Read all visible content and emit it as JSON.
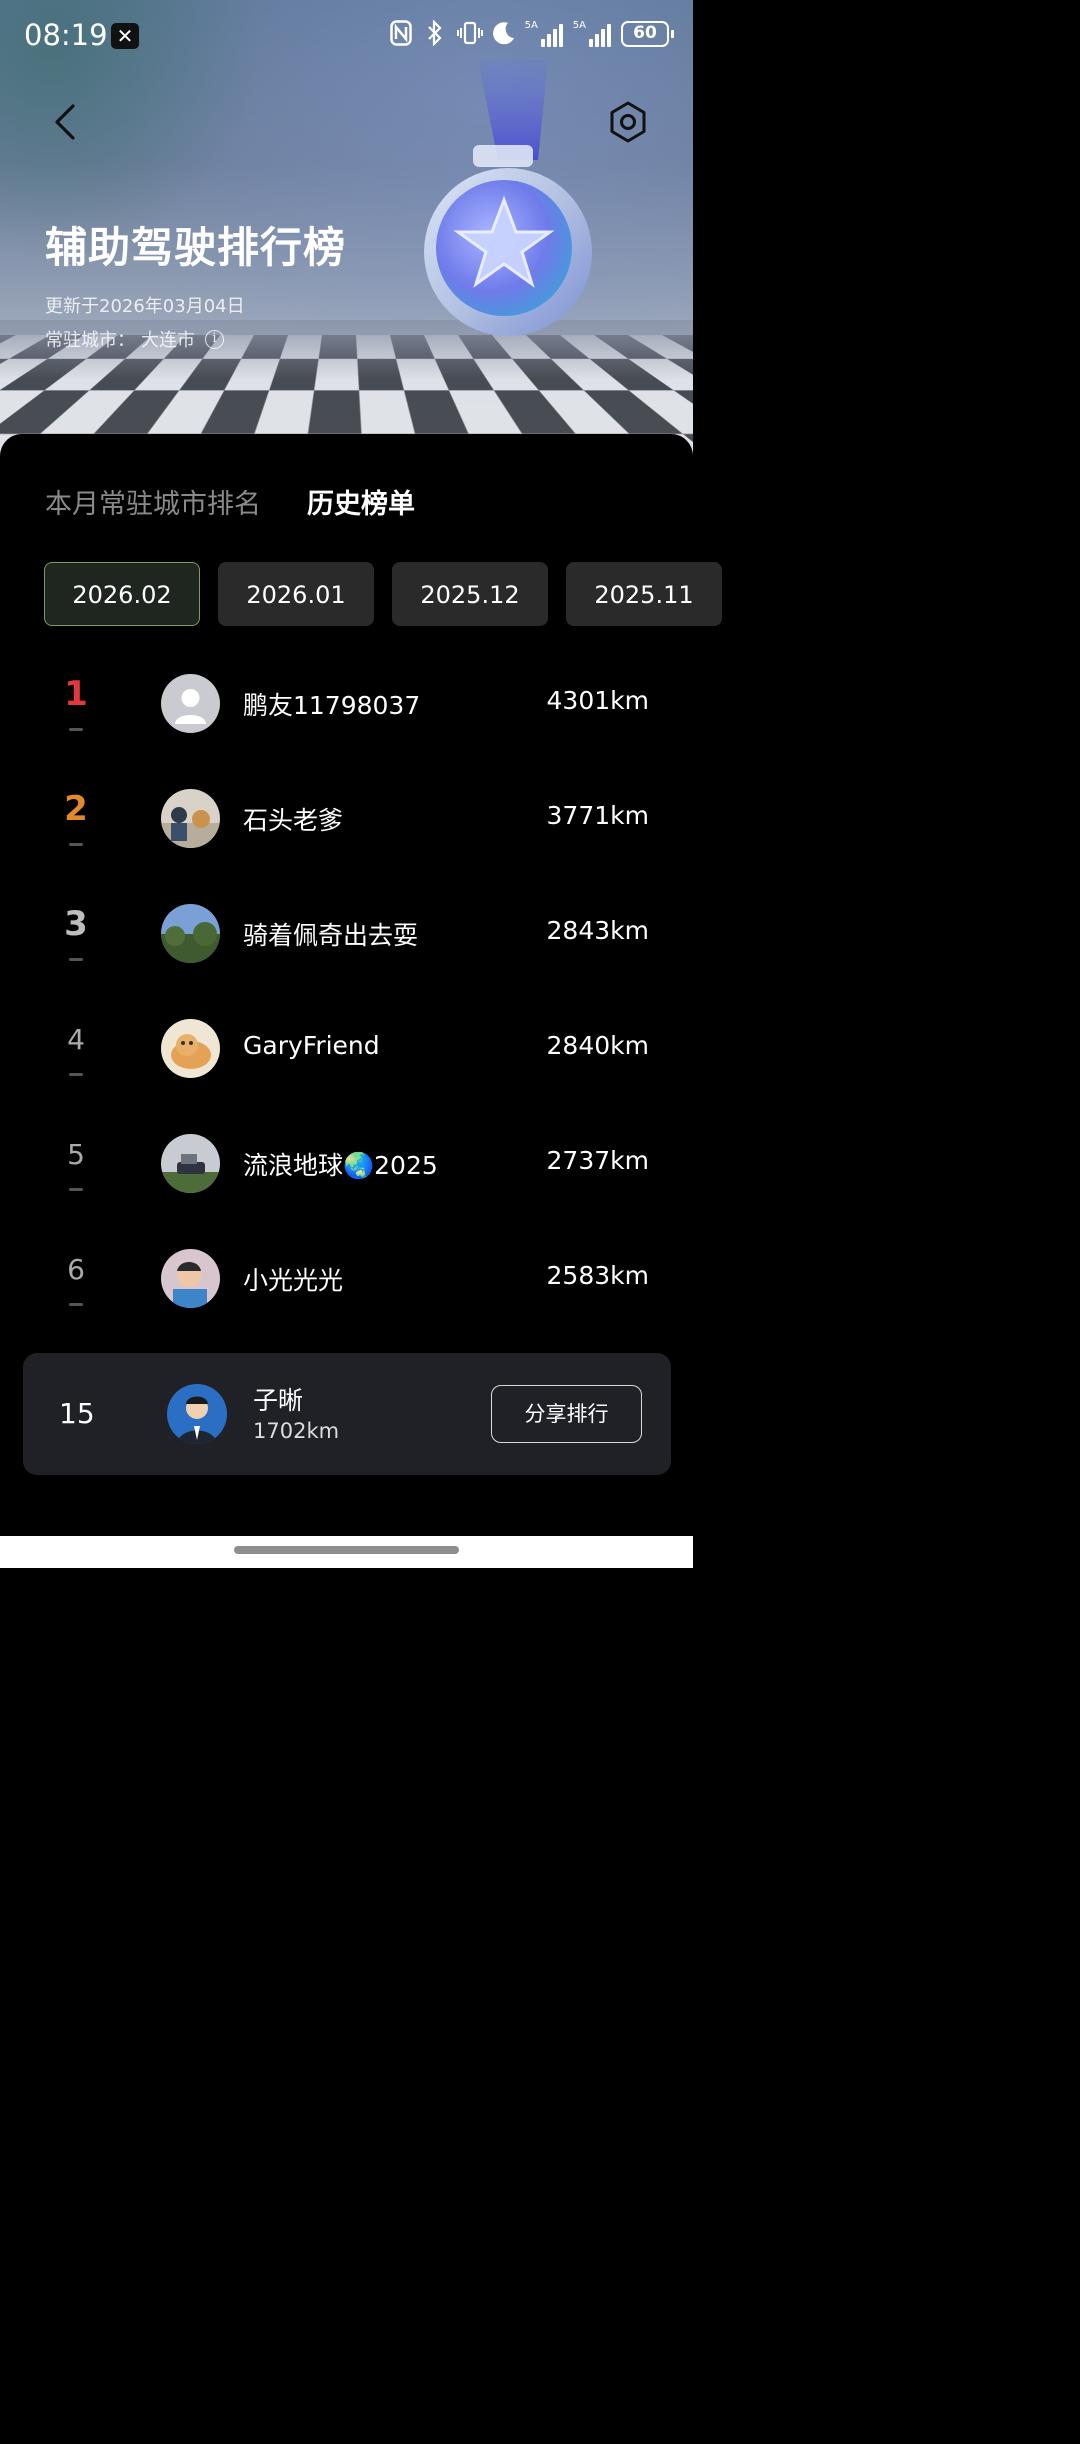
{
  "status_bar": {
    "time": "08:19",
    "signal1_label": "5A",
    "signal2_label": "5A",
    "battery": "60",
    "icons": [
      "app-x-icon",
      "nfc-icon",
      "bluetooth-icon",
      "vibrate-icon",
      "moon-icon"
    ]
  },
  "header": {
    "title": "辅助驾驶排行榜",
    "update_text": "更新于2026年03月04日",
    "city_label": "常驻城市：",
    "city_value": "大连市",
    "info_icon": "i"
  },
  "tabs": [
    {
      "label": "本月常驻城市排名",
      "active": false
    },
    {
      "label": "历史榜单",
      "active": true
    }
  ],
  "periods": [
    {
      "label": "2026.02",
      "active": true
    },
    {
      "label": "2026.01",
      "active": false
    },
    {
      "label": "2025.12",
      "active": false
    },
    {
      "label": "2025.11",
      "active": false
    }
  ],
  "ranking": [
    {
      "rank": "1",
      "name": "鹏友11798037",
      "km": "4301km",
      "rank_color": "#e0383c"
    },
    {
      "rank": "2",
      "name": "石头老爹",
      "km": "3771km",
      "rank_color": "#e08a2a"
    },
    {
      "rank": "3",
      "name": "骑着佩奇出去耍",
      "km": "2843km",
      "rank_color": "#bdbdbd"
    },
    {
      "rank": "4",
      "name": "GaryFriend",
      "km": "2840km",
      "rank_color": "#aaaaaa"
    },
    {
      "rank": "5",
      "name": "流浪地球🌏2025",
      "km": "2737km",
      "rank_color": "#aaaaaa"
    },
    {
      "rank": "6",
      "name": "小光光光",
      "km": "2583km",
      "rank_color": "#aaaaaa"
    }
  ],
  "me": {
    "rank": "15",
    "name": "子晰",
    "km": "1702km",
    "share_label": "分享排行"
  },
  "colors": {
    "accent_border": "#7f9a5f",
    "rank1": "#e0383c",
    "rank2": "#e08a2a"
  }
}
